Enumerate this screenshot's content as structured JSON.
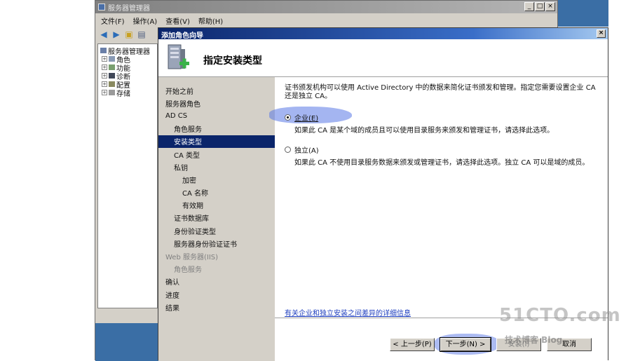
{
  "main_window": {
    "title": "服务器管理器",
    "minimize": "_",
    "maximize": "□",
    "close": "×",
    "menu": [
      "文件(F)",
      "操作(A)",
      "查看(V)",
      "帮助(H)"
    ],
    "tree": [
      {
        "label": "服务器管理器",
        "expander": ""
      },
      {
        "label": "角色",
        "expander": "+"
      },
      {
        "label": "功能",
        "expander": "+"
      },
      {
        "label": "诊断",
        "expander": "+"
      },
      {
        "label": "配置",
        "expander": "+"
      },
      {
        "label": "存储",
        "expander": "+"
      }
    ]
  },
  "wizard": {
    "title": "添加角色向导",
    "close": "×",
    "heading": "指定安装类型",
    "nav": [
      {
        "label": "开始之前",
        "level": 0,
        "state": "normal"
      },
      {
        "label": "服务器角色",
        "level": 0,
        "state": "normal"
      },
      {
        "label": "AD CS",
        "level": 0,
        "state": "normal"
      },
      {
        "label": "角色服务",
        "level": 1,
        "state": "normal"
      },
      {
        "label": "安装类型",
        "level": 1,
        "state": "current"
      },
      {
        "label": "CA 类型",
        "level": 1,
        "state": "normal"
      },
      {
        "label": "私钥",
        "level": 1,
        "state": "normal"
      },
      {
        "label": "加密",
        "level": 2,
        "state": "normal"
      },
      {
        "label": "CA 名称",
        "level": 2,
        "state": "normal"
      },
      {
        "label": "有效期",
        "level": 2,
        "state": "normal"
      },
      {
        "label": "证书数据库",
        "level": 1,
        "state": "normal"
      },
      {
        "label": "身份验证类型",
        "level": 1,
        "state": "normal"
      },
      {
        "label": "服务器身份验证证书",
        "level": 1,
        "state": "normal"
      },
      {
        "label": "Web 服务器(IIS)",
        "level": 0,
        "state": "disabled"
      },
      {
        "label": "角色服务",
        "level": 1,
        "state": "disabled"
      },
      {
        "label": "确认",
        "level": 0,
        "state": "normal"
      },
      {
        "label": "进度",
        "level": 0,
        "state": "normal"
      },
      {
        "label": "结果",
        "level": 0,
        "state": "normal"
      }
    ],
    "intro": "证书颁发机构可以使用 Active Directory 中的数据来简化证书颁发和管理。指定您需要设置企业 CA 还是独立 CA。",
    "options": [
      {
        "label": "企业(E)",
        "selected": true,
        "description": "如果此 CA 是某个域的成员且可以使用目录服务来颁发和管理证书，请选择此选项。"
      },
      {
        "label": "独立(A)",
        "selected": false,
        "description": "如果此 CA 不使用目录服务数据来颁发或管理证书，请选择此选项。独立 CA 可以是域的成员。"
      }
    ],
    "details_link": "有关企业和独立安装之间差异的详细信息",
    "buttons": {
      "back": "< 上一步(P)",
      "next": "下一步(N) >",
      "install": "安装(I)",
      "cancel": "取消"
    }
  },
  "watermark": {
    "line1": "51CTO.com",
    "line2": "技术博客  Blog"
  }
}
